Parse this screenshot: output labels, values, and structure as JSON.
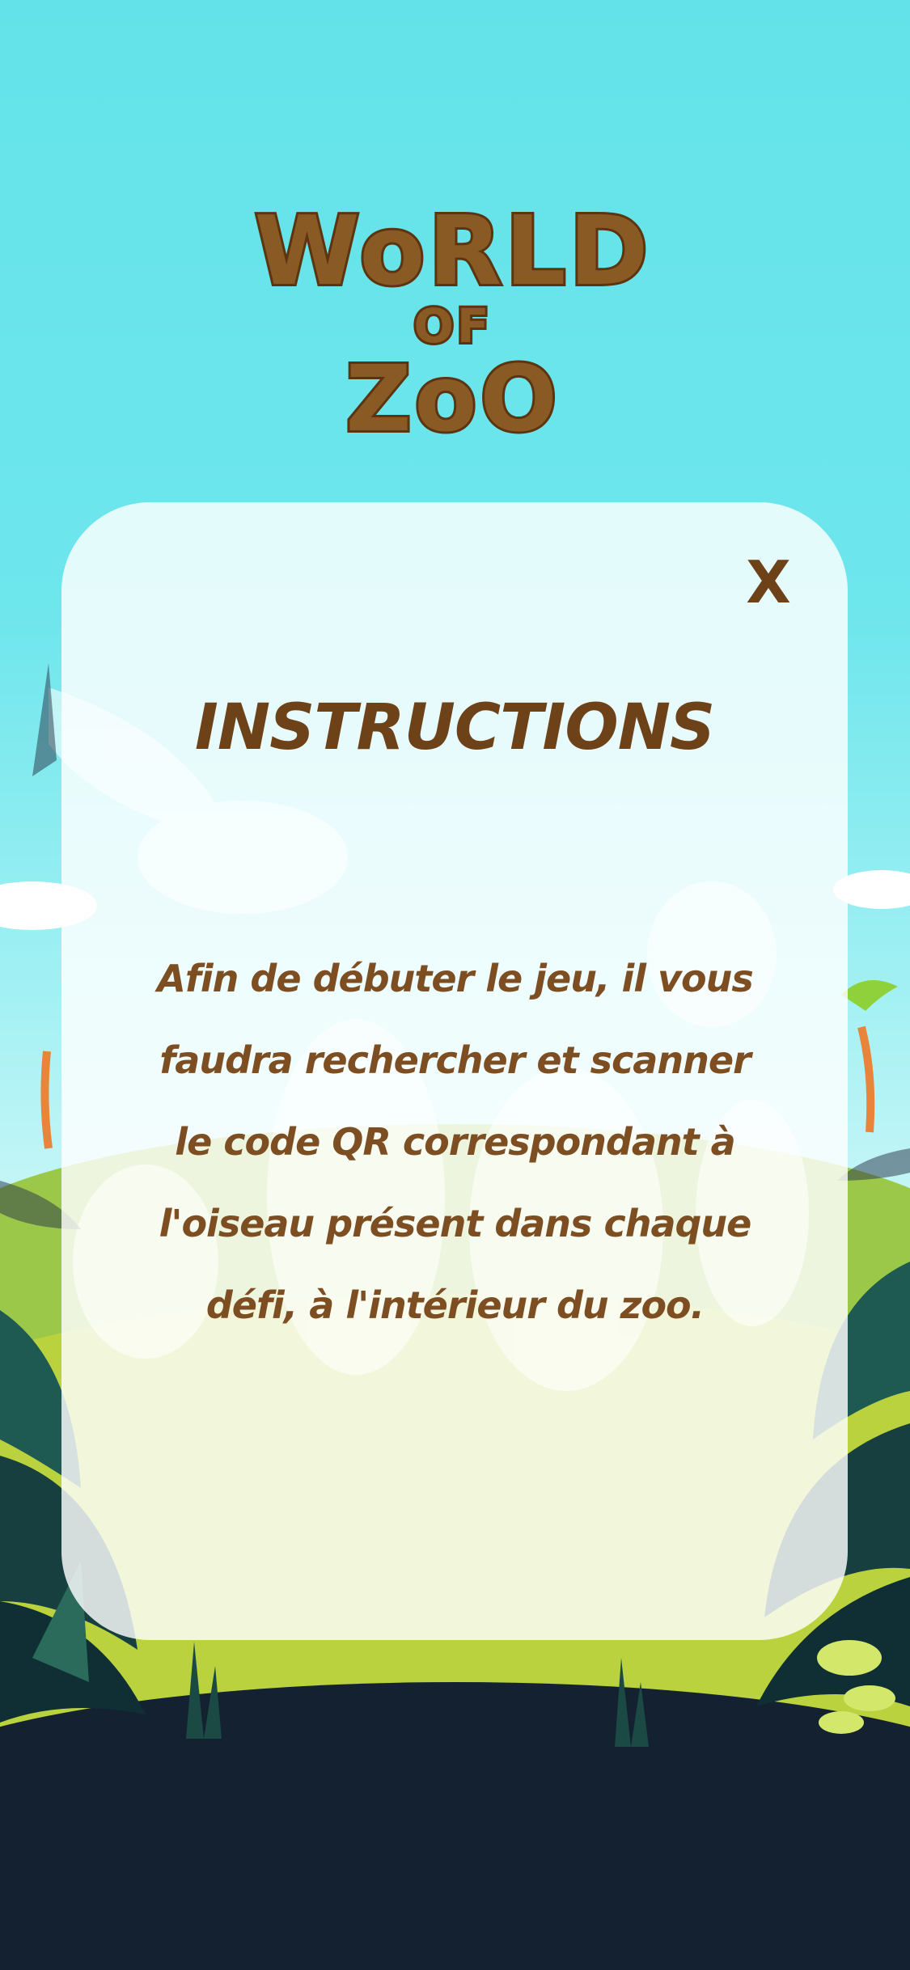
{
  "logo": {
    "line1": "WoRLD",
    "line2": "OF",
    "line3": "ZoO"
  },
  "dialog": {
    "close_label": "X",
    "title": "INSTRUCTIONS",
    "body_lines": [
      "Afin de débuter le jeu, il vous",
      "faudra rechercher et scanner",
      "le code QR correspondant à",
      "l'oiseau présent dans chaque",
      "défi, à l'intérieur du zoo."
    ]
  },
  "colors": {
    "sky": "#63e3e9",
    "grass": "#b9d23e",
    "ground": "#142130",
    "text_brown": "#7d4e22",
    "panel": "#ffffff"
  }
}
